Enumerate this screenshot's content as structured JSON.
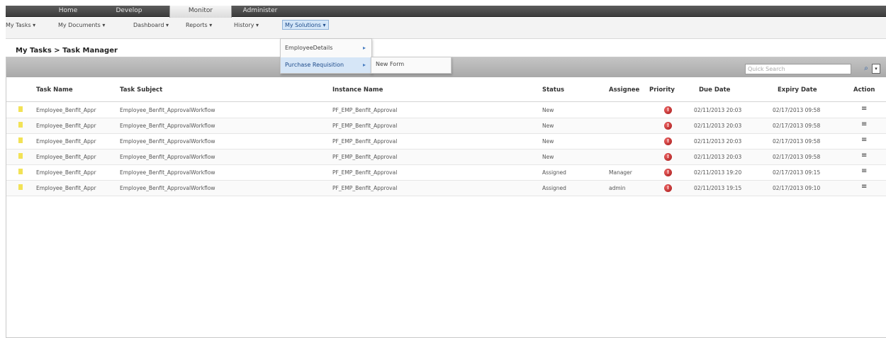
{
  "top_tabs": [
    {
      "label": "Home"
    },
    {
      "label": "Develop"
    },
    {
      "label": "Monitor"
    },
    {
      "label": "Administer"
    }
  ],
  "menu": [
    {
      "label": "My Tasks ▾"
    },
    {
      "label": "My Documents ▾"
    },
    {
      "label": "Dashboard ▾"
    },
    {
      "label": "Reports ▾"
    },
    {
      "label": "History ▾"
    },
    {
      "label": "My Solutions ▾"
    }
  ],
  "breadcrumb": "My Tasks > Task Manager",
  "dropdown": {
    "items": [
      {
        "label": "EmployeeDetails",
        "arrow": "▸"
      },
      {
        "label": "Purchase Requisition",
        "arrow": "▸"
      }
    ],
    "submenu": {
      "label": "New Form"
    }
  },
  "search": {
    "placeholder": "Quick Search"
  },
  "columns": {
    "task_name": "Task Name",
    "task_subject": "Task Subject",
    "instance_name": "Instance Name",
    "status": "Status",
    "assignee": "Assignee",
    "priority": "Priority",
    "due_date": "Due Date",
    "expiry_date": "Expiry Date",
    "action": "Action"
  },
  "rows": [
    {
      "task_name": "Employee_Benfit_Appr",
      "task_subject": "Employee_Benfit_ApprovalWorkflow",
      "instance_name": "PF_EMP_Benfit_Approval",
      "status": "New",
      "assignee": "",
      "priority": "!",
      "due_date": "02/11/2013 20:03",
      "expiry_date": "02/17/2013 09:58",
      "action": "≡"
    },
    {
      "task_name": "Employee_Benfit_Appr",
      "task_subject": "Employee_Benfit_ApprovalWorkflow",
      "instance_name": "PF_EMP_Benfit_Approval",
      "status": "New",
      "assignee": "",
      "priority": "!",
      "due_date": "02/11/2013 20:03",
      "expiry_date": "02/17/2013 09:58",
      "action": "≡"
    },
    {
      "task_name": "Employee_Benfit_Appr",
      "task_subject": "Employee_Benfit_ApprovalWorkflow",
      "instance_name": "PF_EMP_Benfit_Approval",
      "status": "New",
      "assignee": "",
      "priority": "!",
      "due_date": "02/11/2013 20:03",
      "expiry_date": "02/17/2013 09:58",
      "action": "≡"
    },
    {
      "task_name": "Employee_Benfit_Appr",
      "task_subject": "Employee_Benfit_ApprovalWorkflow",
      "instance_name": "PF_EMP_Benfit_Approval",
      "status": "New",
      "assignee": "",
      "priority": "!",
      "due_date": "02/11/2013 20:03",
      "expiry_date": "02/17/2013 09:58",
      "action": "≡"
    },
    {
      "task_name": "Employee_Benfit_Appr",
      "task_subject": "Employee_Benfit_ApprovalWorkflow",
      "instance_name": "PF_EMP_Benfit_Approval",
      "status": "Assigned",
      "assignee": "Manager",
      "priority": "!",
      "due_date": "02/11/2013 19:20",
      "expiry_date": "02/17/2013 09:15",
      "action": "≡"
    },
    {
      "task_name": "Employee_Benfit_Appr",
      "task_subject": "Employee_Benfit_ApprovalWorkflow",
      "instance_name": "PF_EMP_Benfit_Approval",
      "status": "Assigned",
      "assignee": "admin",
      "priority": "!",
      "due_date": "02/11/2013 19:15",
      "expiry_date": "02/17/2013 09:10",
      "action": "≡"
    }
  ],
  "icons": {
    "search": "⌕",
    "options": "▾"
  },
  "colors": {
    "topbar": "#3c3c3c",
    "selected_menu": "#d4e6f8",
    "priority": "#a31515",
    "flag": "#f2e256"
  }
}
